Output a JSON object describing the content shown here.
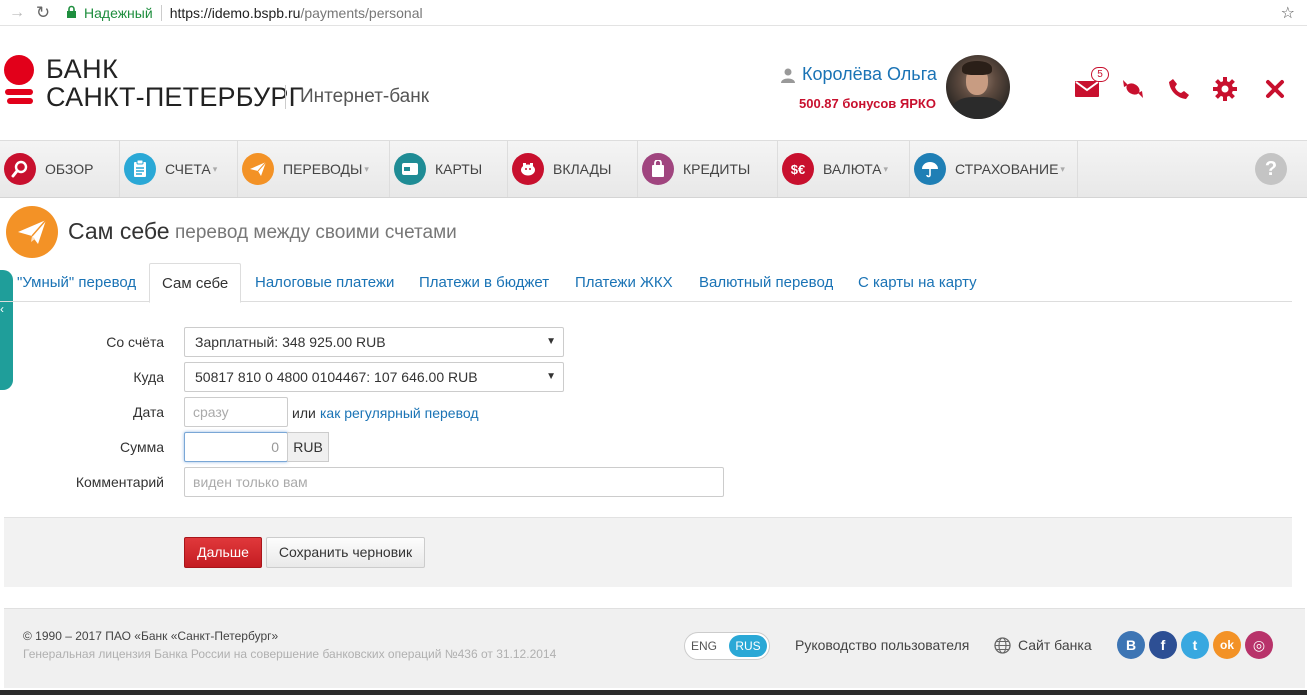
{
  "browser": {
    "secure_label": "Надежный",
    "url_host": "https://idemo.bspb.ru",
    "url_path": "/payments/personal"
  },
  "header": {
    "logo_line1": "БАНК",
    "logo_line2": "САНКТ-ПЕТЕРБУРГ",
    "logo_sub": "Интернет-банк",
    "user_name": "Королёва Ольга",
    "bonus": "500.87 бонусов ЯРКО",
    "mail_count": "5",
    "accent": "#c8102e"
  },
  "nav": {
    "items": [
      {
        "label": "ОБЗОР",
        "icon": "search-icon",
        "color": "#c8102e"
      },
      {
        "label": "СЧЕТА",
        "icon": "clipboard-icon",
        "color": "#2aa8d6"
      },
      {
        "label": "ПЕРЕВОДЫ",
        "icon": "paper-plane-icon",
        "color": "#f39226"
      },
      {
        "label": "КАРТЫ",
        "icon": "card-icon",
        "color": "#1f8c95"
      },
      {
        "label": "ВКЛАДЫ",
        "icon": "piggy-bank-icon",
        "color": "#c8102e"
      },
      {
        "label": "КРЕДИТЫ",
        "icon": "bag-icon",
        "color": "#a0457f"
      },
      {
        "label": "ВАЛЮТА",
        "icon": "currency-icon",
        "color": "#c8102e"
      },
      {
        "label": "СТРАХОВАНИЕ",
        "icon": "umbrella-icon",
        "color": "#1f7fb5"
      }
    ],
    "help": "?"
  },
  "page": {
    "title": "Сам себе",
    "subtitle": "перевод между своими счетами"
  },
  "tabs": [
    {
      "label": "\"Умный\" перевод"
    },
    {
      "label": "Сам себе"
    },
    {
      "label": "Налоговые платежи"
    },
    {
      "label": "Платежи в бюджет"
    },
    {
      "label": "Платежи ЖКХ"
    },
    {
      "label": "Валютный перевод"
    },
    {
      "label": "С карты на карту"
    }
  ],
  "form": {
    "from_label": "Со счёта",
    "from_value": "Зарплатный: 348 925.00 RUB",
    "to_label": "Куда",
    "to_value": "50817 810 0 4800 0104467: 107 646.00 RUB",
    "date_label": "Дата",
    "date_placeholder": "сразу",
    "date_or": "или",
    "date_link": "как регулярный перевод",
    "sum_label": "Сумма",
    "sum_value": "0",
    "currency": "RUB",
    "comment_label": "Комментарий",
    "comment_placeholder": "виден только вам"
  },
  "actions": {
    "next": "Дальше",
    "draft": "Сохранить черновик"
  },
  "footer": {
    "copyright": "© 1990 – 2017 ПАО «Банк «Санкт-Петербург»",
    "license": "Генеральная лицензия Банка России на совершение банковских операций №436 от 31.12.2014",
    "lang_eng": "ENG",
    "lang_rus": "RUS",
    "guide": "Руководство пользователя",
    "site": "Сайт банка",
    "social": [
      {
        "name": "vk",
        "glyph": "В",
        "color": "#3d75b4"
      },
      {
        "name": "facebook",
        "glyph": "f",
        "color": "#2d4f94"
      },
      {
        "name": "twitter",
        "glyph": "t",
        "color": "#38a8e0"
      },
      {
        "name": "odnoklassniki",
        "glyph": "ok",
        "color": "#f39226"
      },
      {
        "name": "instagram",
        "glyph": "◎",
        "color": "#b8336a"
      }
    ]
  }
}
